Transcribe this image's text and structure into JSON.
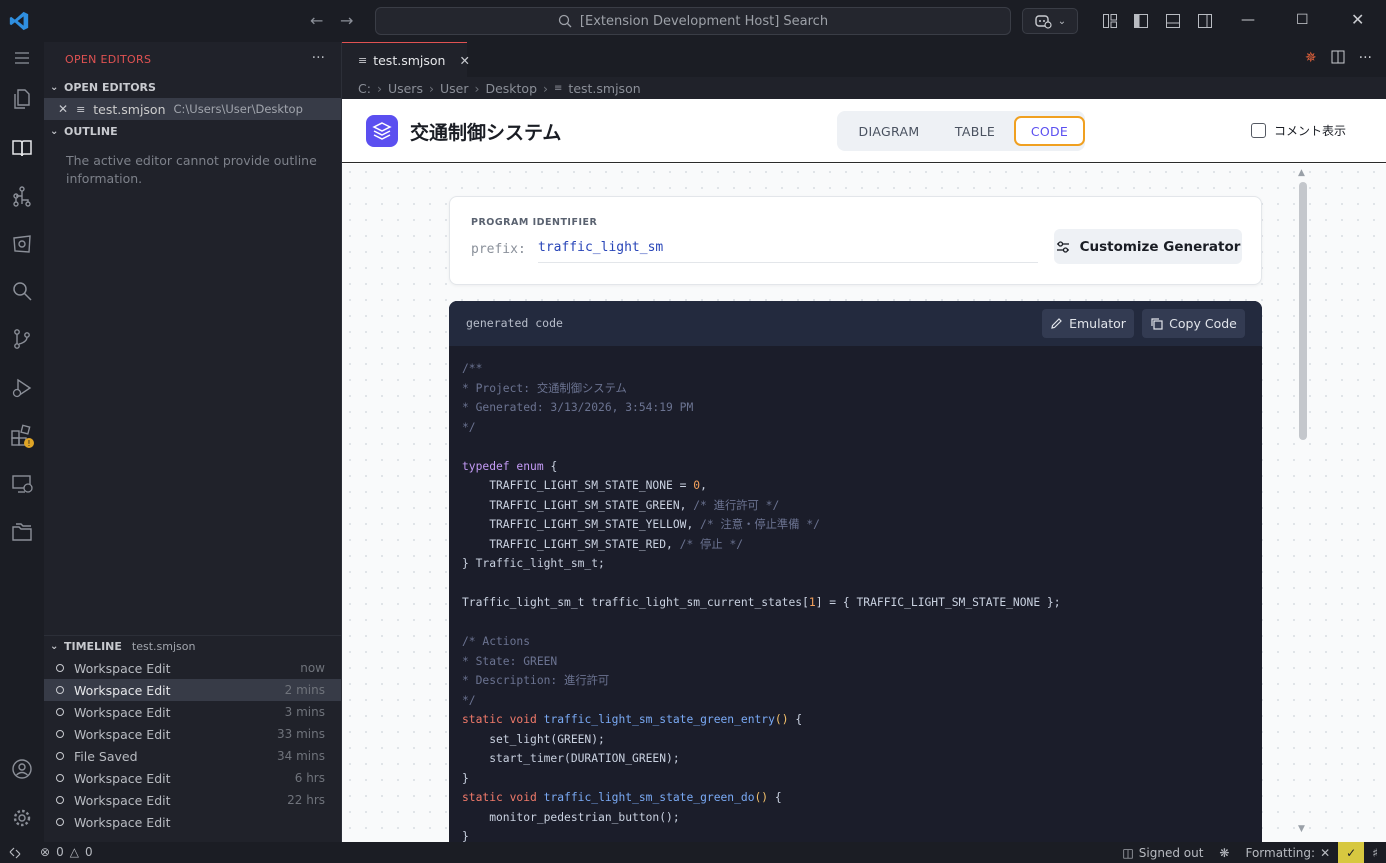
{
  "titlebar": {
    "search_text": "[Extension Development Host] Search"
  },
  "sidebar": {
    "header": "OPEN EDITORS",
    "open_editors": {
      "title": "OPEN EDITORS",
      "item": {
        "name": "test.smjson",
        "path": "C:\\Users\\User\\Desktop"
      }
    },
    "outline": {
      "title": "OUTLINE",
      "message": "The active editor cannot provide outline information."
    },
    "timeline": {
      "title": "TIMELINE",
      "file": "test.smjson",
      "rows": [
        {
          "label": "Workspace Edit",
          "time": "now"
        },
        {
          "label": "Workspace Edit",
          "time": "2 mins"
        },
        {
          "label": "Workspace Edit",
          "time": "3 mins"
        },
        {
          "label": "Workspace Edit",
          "time": "33 mins"
        },
        {
          "label": "File Saved",
          "time": "34 mins"
        },
        {
          "label": "Workspace Edit",
          "time": "6 hrs"
        },
        {
          "label": "Workspace Edit",
          "time": "22 hrs"
        },
        {
          "label": "Workspace Edit",
          "time": ""
        }
      ]
    }
  },
  "editor": {
    "tab_label": "test.smjson",
    "breadcrumb": [
      "C:",
      "Users",
      "User",
      "Desktop",
      "test.smjson"
    ]
  },
  "app": {
    "title": "交通制御システム",
    "tabs": [
      "DIAGRAM",
      "TABLE",
      "CODE"
    ],
    "active_tab": "CODE",
    "comment_toggle": "コメント表示",
    "program_identifier_label": "PROGRAM IDENTIFIER",
    "prefix_label": "prefix:",
    "prefix_value": "traffic_light_sm",
    "customize_button": "Customize Generator",
    "code_header_label": "generated code",
    "emulator_button": "Emulator",
    "copy_button": "Copy Code"
  },
  "code_lines": [
    "/**",
    "* Project: 交通制御システム",
    "* Generated: 3/13/2026, 3:54:19 PM",
    "*/",
    "",
    "typedef enum {",
    "    TRAFFIC_LIGHT_SM_STATE_NONE = 0,",
    "    TRAFFIC_LIGHT_SM_STATE_GREEN, /* 進行許可 */",
    "    TRAFFIC_LIGHT_SM_STATE_YELLOW, /* 注意・停止準備 */",
    "    TRAFFIC_LIGHT_SM_STATE_RED, /* 停止 */",
    "} Traffic_light_sm_t;",
    "",
    "Traffic_light_sm_t traffic_light_sm_current_states[1] = { TRAFFIC_LIGHT_SM_STATE_NONE };",
    "",
    "/* Actions",
    "* State: GREEN",
    "* Description: 進行許可",
    "*/",
    "static void traffic_light_sm_state_green_entry() {",
    "    set_light(GREEN);",
    "    start_timer(DURATION_GREEN);",
    "}",
    "static void traffic_light_sm_state_green_do() {",
    "    monitor_pedestrian_button();",
    "}"
  ],
  "statusbar": {
    "errors": "0",
    "warnings": "0",
    "signed_out": "Signed out",
    "formatting": "Formatting:"
  }
}
